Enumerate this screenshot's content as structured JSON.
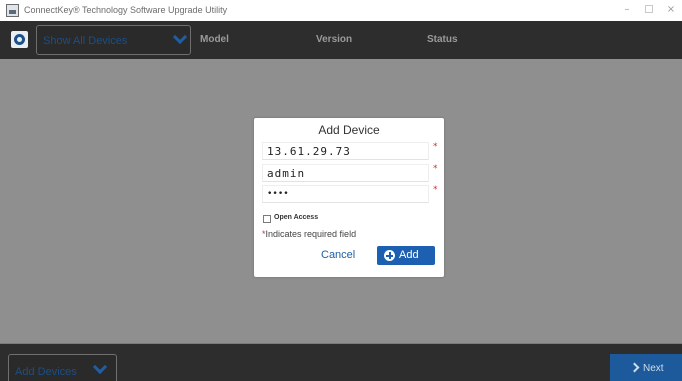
{
  "window": {
    "title": "ConnectKey® Technology Software Upgrade Utility",
    "minimize_glyph": "–",
    "close_glyph": "×"
  },
  "header": {
    "filter_label": "Show All Devices",
    "columns": [
      "Model",
      "Version",
      "Status"
    ]
  },
  "dialog": {
    "title": "Add Device",
    "ip_value": "13.61.29.73",
    "username_value": "admin",
    "password_value": "••••",
    "required_marker": "*",
    "open_access_label": "Open Access",
    "required_note": "Indicates required field",
    "cancel_label": "Cancel",
    "add_label": "Add"
  },
  "footer": {
    "add_devices_label": "Add Devices",
    "next_label": "Next"
  },
  "colors": {
    "accent": "#1d5fb0",
    "header_bg": "#2d2d2d",
    "main_bg": "#8f8f8f",
    "required": "#d32f2f"
  }
}
